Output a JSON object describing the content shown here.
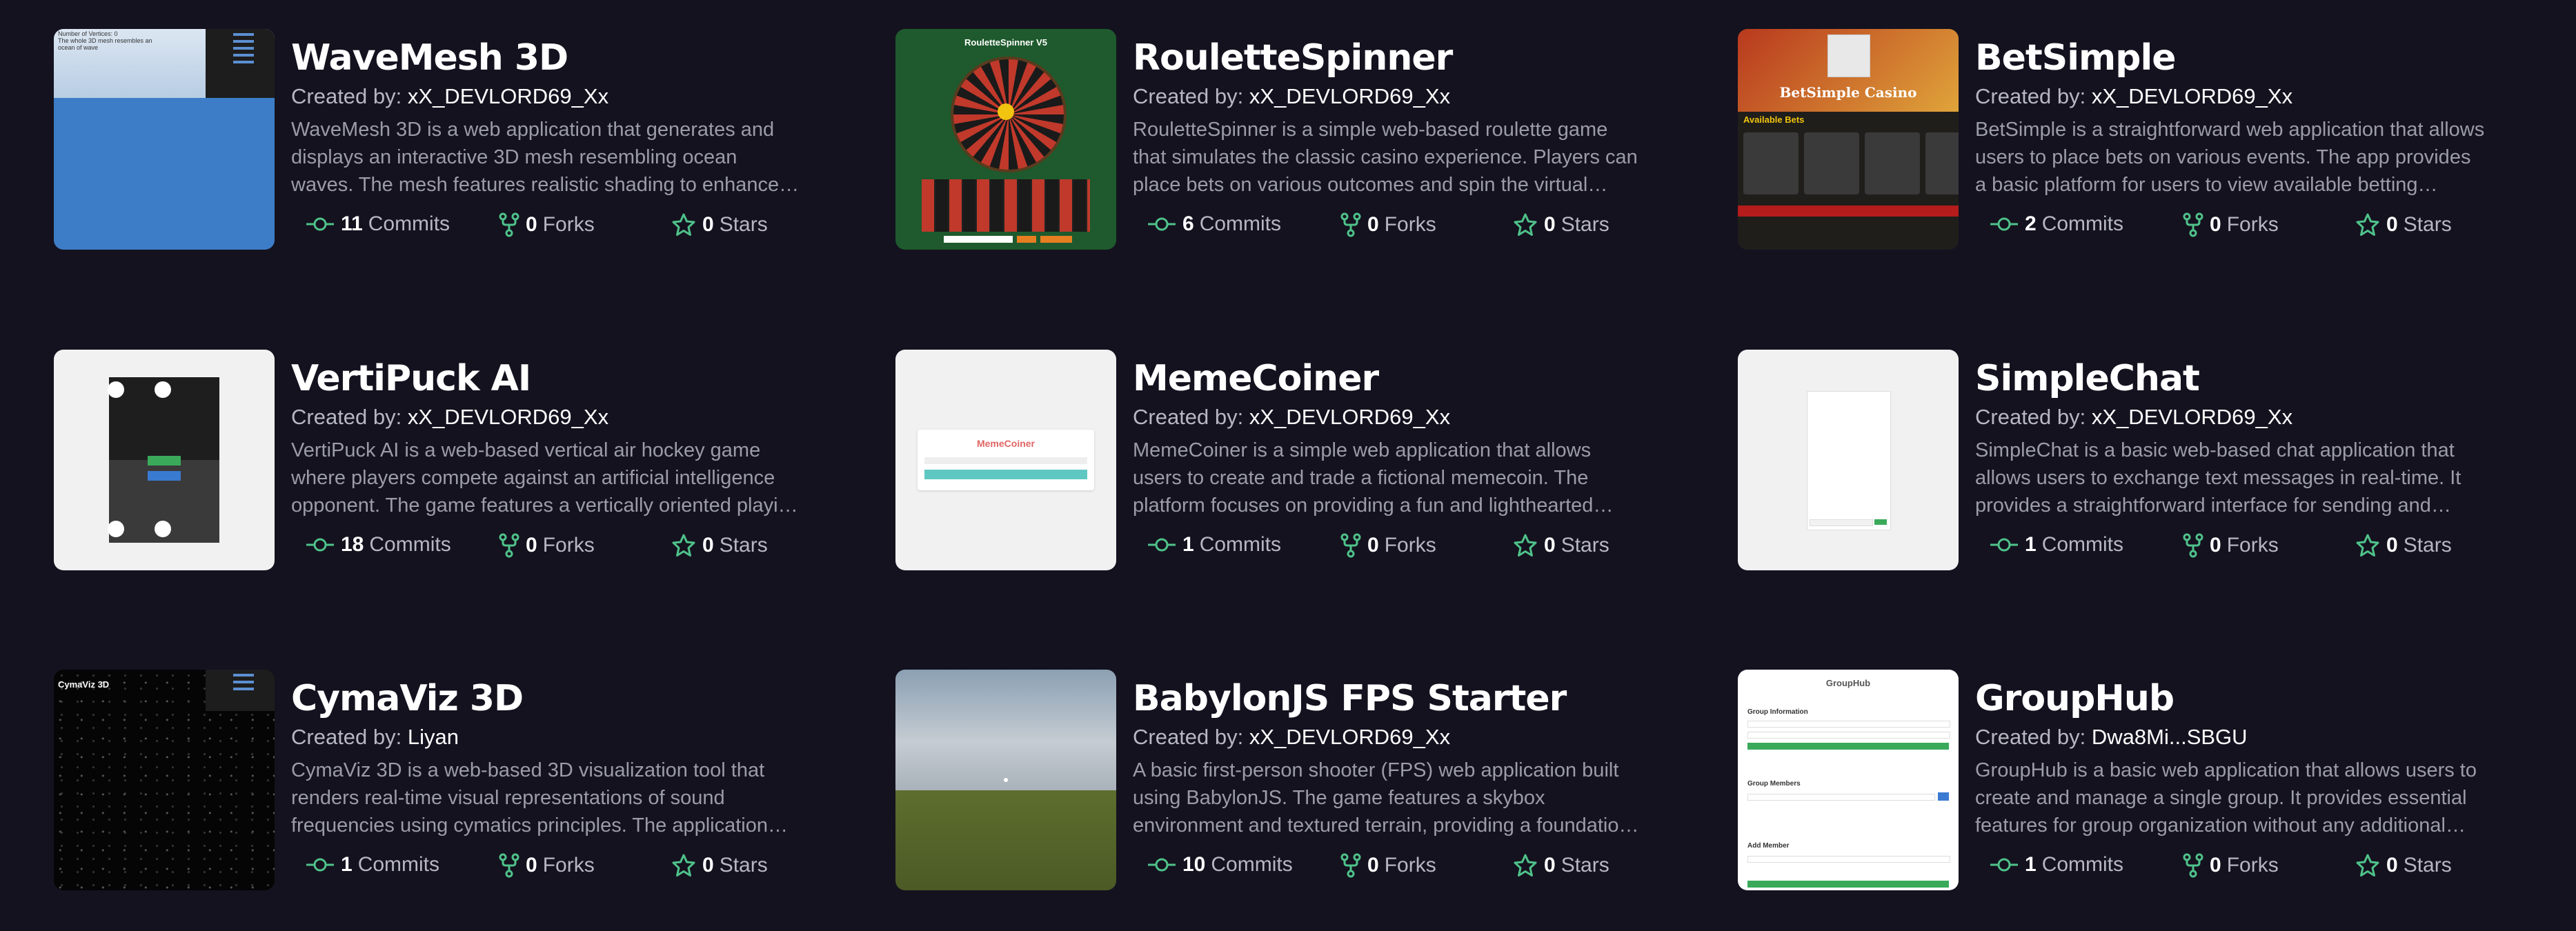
{
  "labels": {
    "created_by": "Created by:",
    "commits": "Commits",
    "forks": "Forks",
    "stars": "Stars"
  },
  "colors": {
    "background": "#14121f",
    "accent_green": "#4fc28a",
    "text_muted": "#9c9ba8"
  },
  "icons": {
    "commits": "commit-icon",
    "forks": "fork-icon",
    "stars": "star-icon"
  },
  "projects": [
    {
      "title": "WaveMesh 3D",
      "creator": "xX_DEVLORD69_Xx",
      "description": "WaveMesh 3D is a web application that generates and displays an interactive 3D mesh resembling ocean waves. The mesh features realistic shading to enhance the illusion of depth and movement.",
      "commits": "11",
      "forks": "0",
      "stars": "0",
      "thumb_text": "Number of Vertices: 0\nThe whole 3D mesh resembles an ocean of wave"
    },
    {
      "title": "RouletteSpinner",
      "creator": "xX_DEVLORD69_Xx",
      "description": "RouletteSpinner is a simple web-based roulette game that simulates the classic casino experience. Players can place bets on various outcomes and spin the virtual roulette wheel.",
      "commits": "6",
      "forks": "0",
      "stars": "0",
      "thumb_text": "RouletteSpinner V5"
    },
    {
      "title": "BetSimple",
      "creator": "xX_DEVLORD69_Xx",
      "description": "BetSimple is a straightforward web application that allows users to place bets on various events. The app provides a basic platform for users to view available betting options, place bets.",
      "commits": "2",
      "forks": "0",
      "stars": "0",
      "thumb_text": "BetSimple Casino",
      "thumb_sub": "Available Bets"
    },
    {
      "title": "VertiPuck AI",
      "creator": "xX_DEVLORD69_Xx",
      "description": "VertiPuck AI is a web-based vertical air hockey game where players compete against an artificial intelligence opponent. The game features a vertically oriented playing field.",
      "commits": "18",
      "forks": "0",
      "stars": "0"
    },
    {
      "title": "MemeCoiner",
      "creator": "xX_DEVLORD69_Xx",
      "description": "MemeCoiner is a simple web application that allows users to create and trade a fictional memecoin. The platform focuses on providing a fun and lighthearted experience for users.",
      "commits": "1",
      "forks": "0",
      "stars": "0",
      "thumb_text": "MemeCoiner"
    },
    {
      "title": "SimpleChat",
      "creator": "xX_DEVLORD69_Xx",
      "description": "SimpleChat is a basic web-based chat application that allows users to exchange text messages in real-time. It provides a straightforward interface for sending and receiving messages.",
      "commits": "1",
      "forks": "0",
      "stars": "0"
    },
    {
      "title": "CymaViz 3D",
      "creator": "Liyan",
      "description": "CymaViz 3D is a web-based 3D visualization tool that renders real-time visual representations of sound frequencies using cymatics principles. The application offers an immersive experience.",
      "commits": "1",
      "forks": "0",
      "stars": "0",
      "thumb_text": "CymaViz 3D"
    },
    {
      "title": "BabylonJS FPS Starter",
      "creator": "xX_DEVLORD69_Xx",
      "description": "A basic first-person shooter (FPS) web application built using BabylonJS. The game features a skybox environment and textured terrain, providing a foundation for further FPS development.",
      "commits": "10",
      "forks": "0",
      "stars": "0"
    },
    {
      "title": "GroupHub",
      "creator": "Dwa8Mi...SBGU",
      "description": "GroupHub is a basic web application that allows users to create and manage a single group. It provides essential features for group organization without any additional complexity.",
      "commits": "1",
      "forks": "0",
      "stars": "0",
      "thumb_text": "GroupHub",
      "thumb_sub": "Group Information",
      "thumb_sub2": "Group Members",
      "thumb_sub3": "Add Member"
    }
  ]
}
